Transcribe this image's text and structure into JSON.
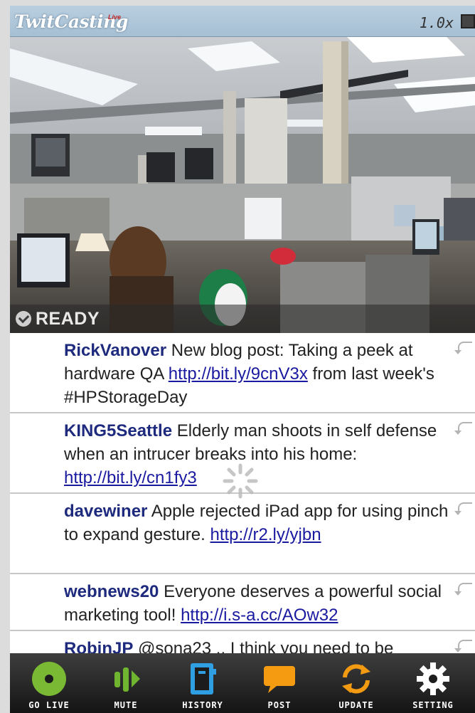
{
  "header": {
    "logo": "TwitCasting",
    "logo_sub": "Live",
    "zoom": "1.0x",
    "stop_icon": "stop-square-icon"
  },
  "status": {
    "icon": "check-circle-icon",
    "label": "READY"
  },
  "tweets": [
    {
      "user": "RickVanover",
      "pre": " New blog post: Taking a peek at hardware QA ",
      "link": "http://bit.ly/9cnV3x",
      "post": " from last week's #HPStorageDay"
    },
    {
      "user": "KING5Seattle",
      "pre": " Elderly man shoots in self defense when an intrucer breaks into his home: ",
      "link": "http://bit.ly/cn1fy3",
      "post": ""
    },
    {
      "user": "davewiner",
      "pre": " Apple rejected iPad app for using pinch to expand gesture. ",
      "link": "http://r2.ly/yjbn",
      "post": ""
    },
    {
      "user": "webnews20",
      "pre": " Everyone deserves a powerful social marketing tool! ",
      "link": "http://i.s-a.cc/AOw32",
      "post": ""
    },
    {
      "user": "RobinJP",
      "pre": " @sona23 .. I think you need to be",
      "link": "",
      "post": ""
    }
  ],
  "tabs": [
    {
      "label": "GO LIVE",
      "icon": "go-live-icon",
      "color": "#7ab933"
    },
    {
      "label": "MUTE",
      "icon": "mute-icon",
      "color": "#6fb52f"
    },
    {
      "label": "HISTORY",
      "icon": "history-icon",
      "color": "#2f9ee3"
    },
    {
      "label": "POST",
      "icon": "post-bubble-icon",
      "color": "#f59b12"
    },
    {
      "label": "UPDATE",
      "icon": "update-arrows-icon",
      "color": "#f39a13"
    },
    {
      "label": "SETTING",
      "icon": "gear-icon",
      "color": "#ffffff"
    }
  ],
  "colors": {
    "user_name": "#1e2a7d",
    "link": "#1a1aa0",
    "tabbar": "#1c1c1c"
  }
}
